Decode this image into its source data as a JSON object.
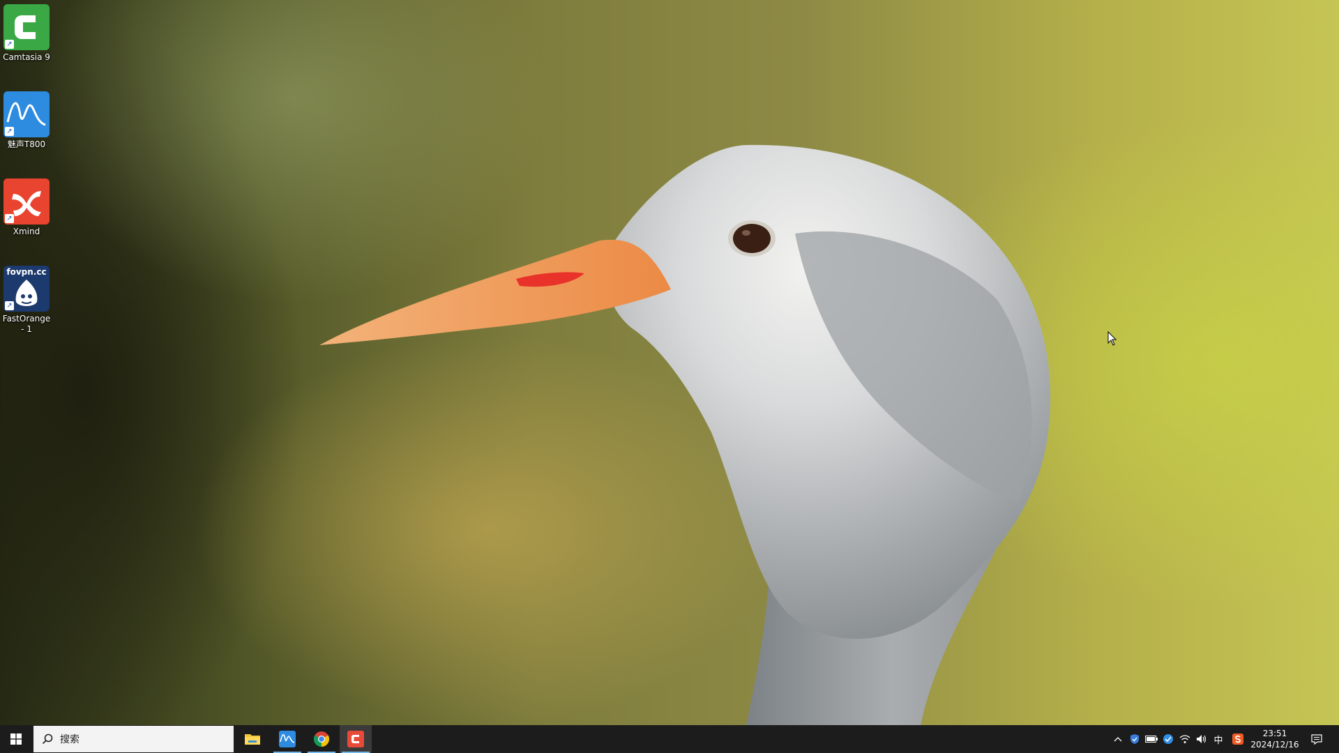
{
  "desktop": {
    "icons": [
      {
        "label": "Camtasia 9",
        "icon": "camtasia-icon",
        "color": "#2e9e3f"
      },
      {
        "label": "魅声T800",
        "icon": "meisheng-icon",
        "color": "#1e7fd8"
      },
      {
        "label": "Xmind",
        "icon": "xmind-icon",
        "color": "#e63b2e"
      },
      {
        "label": "FastOrange - 1",
        "badge": "fovpn.cc",
        "icon": "fastorange-icon",
        "color": "#1c3a6e"
      }
    ],
    "wallpaper": "crane-head-photo"
  },
  "taskbar": {
    "search_placeholder": "搜索",
    "apps": [
      "file-explorer-icon",
      "meisheng-icon",
      "chrome-icon",
      "camtasia-icon"
    ],
    "tray": {
      "input_method": "中",
      "time": "23:51",
      "date": "2024/12/16"
    }
  },
  "colors": {
    "taskbar": "#1c1c1c",
    "accent": "#76b9ed"
  }
}
